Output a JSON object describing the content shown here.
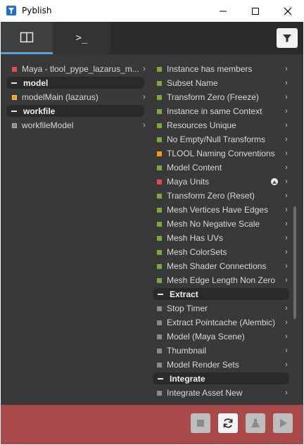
{
  "window": {
    "title": "Pyblish"
  },
  "tabs": {
    "items": [
      {
        "name": "overview",
        "icon": "layout-icon"
      },
      {
        "name": "terminal",
        "label": ">_"
      }
    ]
  },
  "left": {
    "items": [
      {
        "kind": "row",
        "label": "Maya - tlool_pype_lazarus_m...",
        "color": "#e64b4b"
      },
      {
        "kind": "section",
        "label": "model"
      },
      {
        "kind": "row",
        "label": "modelMain (lazarus)",
        "color": "#f39c12"
      },
      {
        "kind": "section",
        "label": "workfile"
      },
      {
        "kind": "row",
        "label": "workfileModel",
        "color": "#8a8a8a"
      }
    ]
  },
  "right": {
    "items": [
      {
        "kind": "row",
        "label": "Instance has members",
        "color": "#77ad37"
      },
      {
        "kind": "row",
        "label": "Subset Name",
        "color": "#77ad37"
      },
      {
        "kind": "row",
        "label": "Transform Zero (Freeze)",
        "color": "#77ad37"
      },
      {
        "kind": "row",
        "label": "Instance in same Context",
        "color": "#77ad37"
      },
      {
        "kind": "row",
        "label": "Resources Unique",
        "color": "#77ad37"
      },
      {
        "kind": "row",
        "label": "No Empty/Null Transforms",
        "color": "#77ad37"
      },
      {
        "kind": "row",
        "label": "TLOOL Naming Conventions",
        "color": "#f39c12"
      },
      {
        "kind": "row",
        "label": "Model Content",
        "color": "#77ad37"
      },
      {
        "kind": "row",
        "label": "Maya Units",
        "color": "#e64b4b",
        "warn": true
      },
      {
        "kind": "row",
        "label": "Transform Zero (Reset)",
        "color": "#77ad37"
      },
      {
        "kind": "row",
        "label": "Mesh Vertices Have Edges",
        "color": "#77ad37"
      },
      {
        "kind": "row",
        "label": "Mesh No Negative Scale",
        "color": "#77ad37"
      },
      {
        "kind": "row",
        "label": "Mesh Has UVs",
        "color": "#77ad37"
      },
      {
        "kind": "row",
        "label": "Mesh ColorSets",
        "color": "#77ad37"
      },
      {
        "kind": "row",
        "label": "Mesh Shader Connections",
        "color": "#77ad37"
      },
      {
        "kind": "row",
        "label": "Mesh Edge Length Non Zero",
        "color": "#77ad37"
      },
      {
        "kind": "section",
        "label": "Extract"
      },
      {
        "kind": "row",
        "label": "Stop Timer",
        "color": "#8a8a8a"
      },
      {
        "kind": "row",
        "label": "Extract Pointcache (Alembic)",
        "color": "#8a8a8a"
      },
      {
        "kind": "row",
        "label": "Model (Maya Scene)",
        "color": "#8a8a8a"
      },
      {
        "kind": "row",
        "label": "Thumbnail",
        "color": "#8a8a8a"
      },
      {
        "kind": "row",
        "label": "Model Render Sets",
        "color": "#8a8a8a"
      },
      {
        "kind": "section",
        "label": "Integrate"
      },
      {
        "kind": "row",
        "label": "Integrate Asset New",
        "color": "#8a8a8a"
      }
    ]
  },
  "footer": {
    "color": "#a94a4a",
    "buttons": [
      {
        "name": "stop-button",
        "icon": "stop-icon",
        "enabled": false
      },
      {
        "name": "reset-button",
        "icon": "refresh-icon",
        "enabled": true
      },
      {
        "name": "validate-button",
        "icon": "flask-icon",
        "enabled": false
      },
      {
        "name": "publish-button",
        "icon": "play-icon",
        "enabled": false
      }
    ]
  }
}
